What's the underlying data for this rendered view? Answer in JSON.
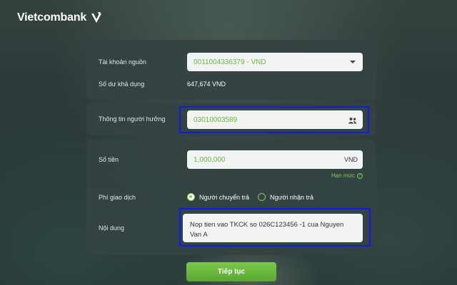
{
  "brand": {
    "name": "Vietcombank"
  },
  "source": {
    "label": "Tài khoản nguồn",
    "account_value": "0011004336379 - VND",
    "balance_label": "Số dư khả dụng",
    "balance_value": "647,674 VND"
  },
  "beneficiary": {
    "label": "Thông tin người hưởng",
    "value": "03010003589"
  },
  "amount": {
    "label": "Số tiền",
    "value": "1,000,000",
    "currency": "VND",
    "limit_link": "Hạn mức",
    "limit_icon": "?"
  },
  "fee": {
    "label": "Phí giao dịch",
    "options": [
      "Người chuyển trả",
      "Người nhận trả"
    ],
    "selected": "Người chuyển trả"
  },
  "content": {
    "label": "Nội dung",
    "value": "Nop tien vao TKCK so 026C123456 -1 cua Nguyen Van A"
  },
  "actions": {
    "continue_label": "Tiếp tục"
  },
  "colors": {
    "accent": "#6db43a",
    "highlight": "#0a1ee6",
    "card": "#344242"
  }
}
